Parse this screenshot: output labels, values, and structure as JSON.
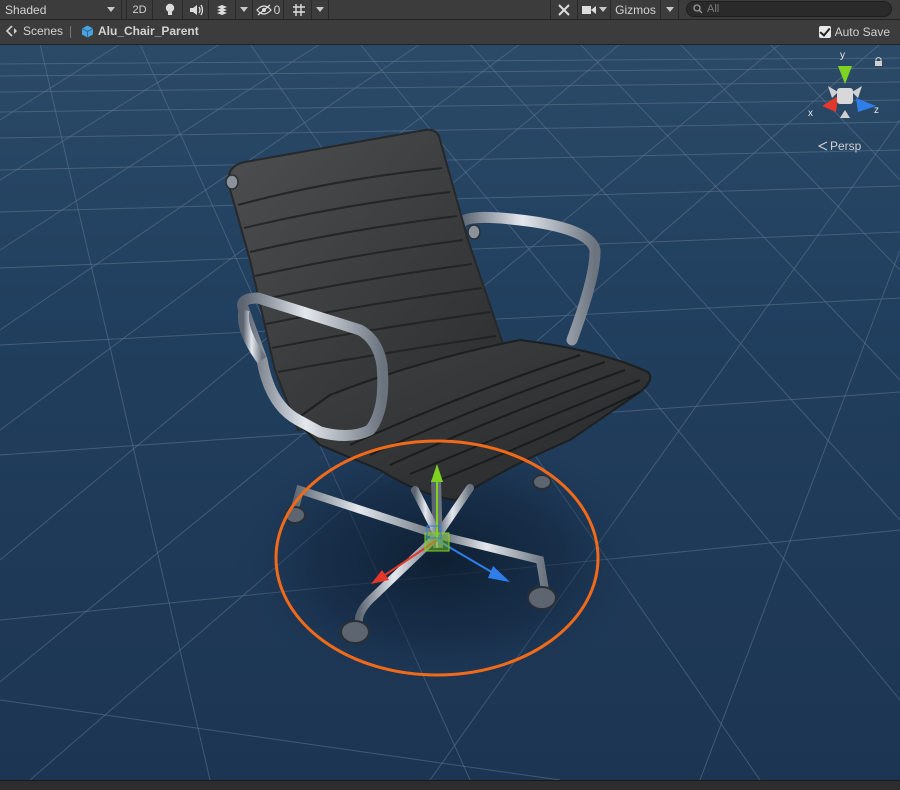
{
  "toolbar": {
    "shading_mode": "Shaded",
    "mode_2d": "2D",
    "hidden_count": "0",
    "gizmos_label": "Gizmos",
    "search_placeholder": "All"
  },
  "breadcrumb": {
    "root": "Scenes",
    "object": "Alu_Chair_Parent",
    "auto_save": "Auto Save"
  },
  "scene_gizmo": {
    "axis_y": "y",
    "axis_x": "x",
    "axis_z": "z",
    "projection": "Persp"
  },
  "icons": [
    "scenes-back-icon",
    "prefab-cube-icon",
    "light-icon",
    "audio-icon",
    "effects-icon",
    "visibility-icon",
    "grid-icon",
    "tools-icon",
    "camera-icon",
    "lock-icon",
    "move-tool-icon"
  ],
  "colors": {
    "toolbar": "#3c3c3c",
    "viewport": "#1e3a57",
    "selection_outline": "#f06a1a",
    "axis_x": "#e2372a",
    "axis_y": "#7ed321",
    "axis_z": "#2f7de8"
  }
}
